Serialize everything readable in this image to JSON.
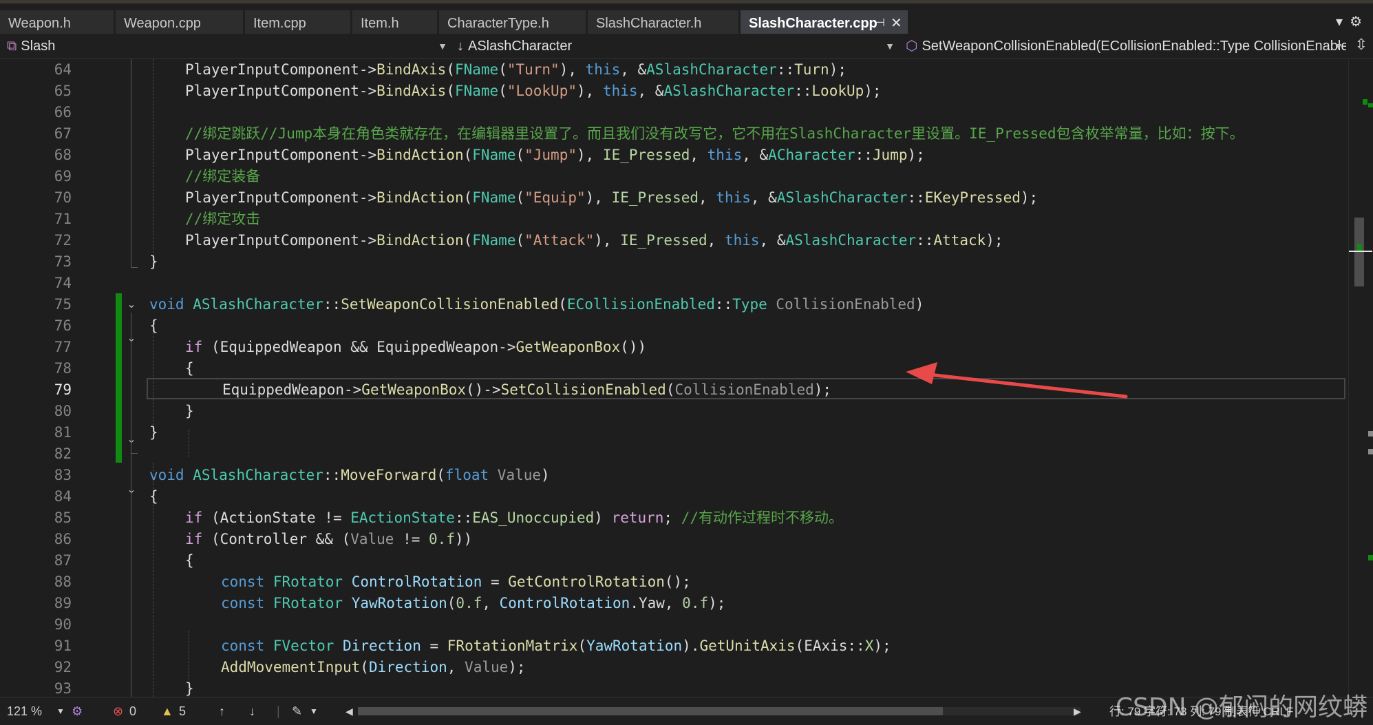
{
  "tabs": [
    {
      "label": "Weapon.h",
      "active": false
    },
    {
      "label": "Weapon.cpp",
      "active": false
    },
    {
      "label": "Item.cpp",
      "active": false
    },
    {
      "label": "Item.h",
      "active": false
    },
    {
      "label": "CharacterType.h",
      "active": false
    },
    {
      "label": "SlashCharacter.h",
      "active": false
    },
    {
      "label": "SlashCharacter.cpp",
      "active": true
    }
  ],
  "tab_controls": {
    "pin_icon": "pin-icon",
    "close_glyph": "✕",
    "dropdown_glyph": "▾",
    "settings_glyph": "⚙"
  },
  "navbar": {
    "project": "Slash",
    "scope": "ASlashCharacter",
    "member": "SetWeaponCollisionEnabled(ECollisionEnabled::Type CollisionEnablec"
  },
  "editor": {
    "current_line": 79,
    "lines": [
      {
        "n": "64",
        "tokens": [
          [
            "PlayerInputComponent->",
            "plain"
          ],
          [
            "BindAxis",
            "fn"
          ],
          [
            "(",
            "plain"
          ],
          [
            "FName",
            "type"
          ],
          [
            "(",
            "plain"
          ],
          [
            "\"Turn\"",
            "str"
          ],
          [
            "), ",
            "plain"
          ],
          [
            "this",
            "kw"
          ],
          [
            ", &",
            "plain"
          ],
          [
            "ASlashCharacter",
            "type"
          ],
          [
            "::",
            "plain"
          ],
          [
            "Turn",
            "fn"
          ],
          [
            ");",
            "plain"
          ]
        ]
      },
      {
        "n": "65",
        "tokens": [
          [
            "PlayerInputComponent->",
            "plain"
          ],
          [
            "BindAxis",
            "fn"
          ],
          [
            "(",
            "plain"
          ],
          [
            "FName",
            "type"
          ],
          [
            "(",
            "plain"
          ],
          [
            "\"LookUp\"",
            "str"
          ],
          [
            "), ",
            "plain"
          ],
          [
            "this",
            "kw"
          ],
          [
            ", &",
            "plain"
          ],
          [
            "ASlashCharacter",
            "type"
          ],
          [
            "::",
            "plain"
          ],
          [
            "LookUp",
            "fn"
          ],
          [
            ");",
            "plain"
          ]
        ]
      },
      {
        "n": "66",
        "tokens": []
      },
      {
        "n": "67",
        "tokens": [
          [
            "//绑定跳跃//Jump本身在角色类就存在，在编辑器里设置了。而且我们没有改写它，它不用在SlashCharacter里设置。IE_Pressed包含枚举常量，比如：按下。",
            "com"
          ]
        ]
      },
      {
        "n": "68",
        "tokens": [
          [
            "PlayerInputComponent->",
            "plain"
          ],
          [
            "BindAction",
            "fn"
          ],
          [
            "(",
            "plain"
          ],
          [
            "FName",
            "type"
          ],
          [
            "(",
            "plain"
          ],
          [
            "\"Jump\"",
            "str"
          ],
          [
            "), ",
            "plain"
          ],
          [
            "IE_Pressed",
            "enum"
          ],
          [
            ", ",
            "plain"
          ],
          [
            "this",
            "kw"
          ],
          [
            ", &",
            "plain"
          ],
          [
            "ACharacter",
            "type"
          ],
          [
            "::",
            "plain"
          ],
          [
            "Jump",
            "fn"
          ],
          [
            ");",
            "plain"
          ]
        ]
      },
      {
        "n": "69",
        "tokens": [
          [
            "//绑定装备",
            "com"
          ]
        ]
      },
      {
        "n": "70",
        "tokens": [
          [
            "PlayerInputComponent->",
            "plain"
          ],
          [
            "BindAction",
            "fn"
          ],
          [
            "(",
            "plain"
          ],
          [
            "FName",
            "type"
          ],
          [
            "(",
            "plain"
          ],
          [
            "\"Equip\"",
            "str"
          ],
          [
            "), ",
            "plain"
          ],
          [
            "IE_Pressed",
            "enum"
          ],
          [
            ", ",
            "plain"
          ],
          [
            "this",
            "kw"
          ],
          [
            ", &",
            "plain"
          ],
          [
            "ASlashCharacter",
            "type"
          ],
          [
            "::",
            "plain"
          ],
          [
            "EKeyPressed",
            "fn"
          ],
          [
            ");",
            "plain"
          ]
        ]
      },
      {
        "n": "71",
        "tokens": [
          [
            "//绑定攻击",
            "com"
          ]
        ]
      },
      {
        "n": "72",
        "tokens": [
          [
            "PlayerInputComponent->",
            "plain"
          ],
          [
            "BindAction",
            "fn"
          ],
          [
            "(",
            "plain"
          ],
          [
            "FName",
            "type"
          ],
          [
            "(",
            "plain"
          ],
          [
            "\"Attack\"",
            "str"
          ],
          [
            "), ",
            "plain"
          ],
          [
            "IE_Pressed",
            "enum"
          ],
          [
            ", ",
            "plain"
          ],
          [
            "this",
            "kw"
          ],
          [
            ", &",
            "plain"
          ],
          [
            "ASlashCharacter",
            "type"
          ],
          [
            "::",
            "plain"
          ],
          [
            "Attack",
            "fn"
          ],
          [
            ");",
            "plain"
          ]
        ]
      },
      {
        "n": "73",
        "tokens": [
          [
            "}",
            "plain"
          ]
        ]
      },
      {
        "n": "74",
        "tokens": []
      },
      {
        "n": "75",
        "tokens": [
          [
            "void",
            "kw"
          ],
          [
            " ",
            "plain"
          ],
          [
            "ASlashCharacter",
            "type"
          ],
          [
            "::",
            "plain"
          ],
          [
            "SetWeaponCollisionEnabled",
            "fn"
          ],
          [
            "(",
            "plain"
          ],
          [
            "ECollisionEnabled",
            "type"
          ],
          [
            "::",
            "plain"
          ],
          [
            "Type",
            "type"
          ],
          [
            " ",
            "plain"
          ],
          [
            "CollisionEnabled",
            "param"
          ],
          [
            ")",
            "plain"
          ]
        ]
      },
      {
        "n": "76",
        "tokens": [
          [
            "{",
            "plain"
          ]
        ]
      },
      {
        "n": "77",
        "tokens": [
          [
            "if",
            "ctl"
          ],
          [
            " (EquippedWeapon && EquippedWeapon->",
            "plain"
          ],
          [
            "GetWeaponBox",
            "fn"
          ],
          [
            "())",
            "plain"
          ]
        ]
      },
      {
        "n": "78",
        "tokens": [
          [
            "{",
            "plain"
          ]
        ]
      },
      {
        "n": "79",
        "tokens": [
          [
            "EquippedWeapon->",
            "plain"
          ],
          [
            "GetWeaponBox",
            "fn"
          ],
          [
            "()->",
            "plain"
          ],
          [
            "SetCollisionEnabled",
            "fn"
          ],
          [
            "(",
            "plain"
          ],
          [
            "CollisionEnabled",
            "param"
          ],
          [
            ");",
            "plain"
          ]
        ]
      },
      {
        "n": "80",
        "tokens": [
          [
            "}",
            "plain"
          ]
        ]
      },
      {
        "n": "81",
        "tokens": [
          [
            "}",
            "plain"
          ]
        ]
      },
      {
        "n": "82",
        "tokens": []
      },
      {
        "n": "83",
        "tokens": [
          [
            "void",
            "kw"
          ],
          [
            " ",
            "plain"
          ],
          [
            "ASlashCharacter",
            "type"
          ],
          [
            "::",
            "plain"
          ],
          [
            "MoveForward",
            "fn"
          ],
          [
            "(",
            "plain"
          ],
          [
            "float",
            "kw"
          ],
          [
            " ",
            "plain"
          ],
          [
            "Value",
            "param"
          ],
          [
            ")",
            "plain"
          ]
        ]
      },
      {
        "n": "84",
        "tokens": [
          [
            "{",
            "plain"
          ]
        ]
      },
      {
        "n": "85",
        "tokens": [
          [
            "if",
            "ctl"
          ],
          [
            " (ActionState != ",
            "plain"
          ],
          [
            "EActionState",
            "type"
          ],
          [
            "::",
            "plain"
          ],
          [
            "EAS_Unoccupied",
            "enum"
          ],
          [
            ") ",
            "plain"
          ],
          [
            "return",
            "ctl"
          ],
          [
            "; ",
            "plain"
          ],
          [
            "//有动作过程时不移动。",
            "com"
          ]
        ]
      },
      {
        "n": "86",
        "tokens": [
          [
            "if",
            "ctl"
          ],
          [
            " (Controller && (",
            "plain"
          ],
          [
            "Value",
            "param"
          ],
          [
            " != ",
            "plain"
          ],
          [
            "0.f",
            "num"
          ],
          [
            "))",
            "plain"
          ]
        ]
      },
      {
        "n": "87",
        "tokens": [
          [
            "{",
            "plain"
          ]
        ]
      },
      {
        "n": "88",
        "tokens": [
          [
            "const",
            "kw"
          ],
          [
            " ",
            "plain"
          ],
          [
            "FRotator",
            "type"
          ],
          [
            " ",
            "plain"
          ],
          [
            "ControlRotation",
            "var"
          ],
          [
            " = ",
            "plain"
          ],
          [
            "GetControlRotation",
            "fn"
          ],
          [
            "();",
            "plain"
          ]
        ]
      },
      {
        "n": "89",
        "tokens": [
          [
            "const",
            "kw"
          ],
          [
            " ",
            "plain"
          ],
          [
            "FRotator",
            "type"
          ],
          [
            " ",
            "plain"
          ],
          [
            "YawRotation",
            "var"
          ],
          [
            "(",
            "plain"
          ],
          [
            "0.f",
            "num"
          ],
          [
            ", ",
            "plain"
          ],
          [
            "ControlRotation",
            "var"
          ],
          [
            ".Yaw, ",
            "plain"
          ],
          [
            "0.f",
            "num"
          ],
          [
            ");",
            "plain"
          ]
        ]
      },
      {
        "n": "90",
        "tokens": []
      },
      {
        "n": "91",
        "tokens": [
          [
            "const",
            "kw"
          ],
          [
            " ",
            "plain"
          ],
          [
            "FVector",
            "type"
          ],
          [
            " ",
            "plain"
          ],
          [
            "Direction",
            "var"
          ],
          [
            " = ",
            "plain"
          ],
          [
            "FRotationMatrix",
            "fn"
          ],
          [
            "(",
            "plain"
          ],
          [
            "YawRotation",
            "var"
          ],
          [
            ").",
            "plain"
          ],
          [
            "GetUnitAxis",
            "fn"
          ],
          [
            "(EAxis::",
            "plain"
          ],
          [
            "X",
            "enum"
          ],
          [
            ");",
            "plain"
          ]
        ]
      },
      {
        "n": "92",
        "tokens": [
          [
            "AddMovementInput",
            "fn"
          ],
          [
            "(",
            "plain"
          ],
          [
            "Direction",
            "var"
          ],
          [
            ", ",
            "plain"
          ],
          [
            "Value",
            "param"
          ],
          [
            ");",
            "plain"
          ]
        ]
      },
      {
        "n": "93",
        "tokens": [
          [
            "}",
            "plain"
          ]
        ]
      }
    ]
  },
  "statusbar": {
    "zoom": "121 %",
    "errors": "0",
    "warnings": "5",
    "position": "行: 79    字符: 73    列: 79    制表符    CRLF"
  },
  "watermark": "CSDN @郁闷的网纹蟒"
}
